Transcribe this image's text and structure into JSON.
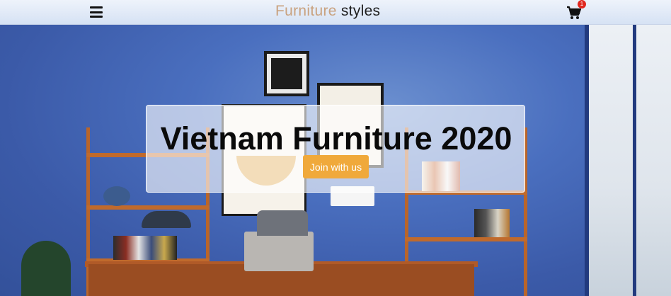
{
  "header": {
    "brand_part1": "Furniture",
    "brand_part2": "styles",
    "menu_icon": "hamburger-menu-icon",
    "cart_icon": "shopping-cart-icon",
    "cart_count": "1"
  },
  "hero": {
    "title": "Vietnam Furniture 2020",
    "button_label": "Join with us"
  },
  "colors": {
    "accent": "#f0a93b",
    "brand_light": "#c9a27f",
    "badge": "#e0271f",
    "wall": "#4a6fbf"
  }
}
